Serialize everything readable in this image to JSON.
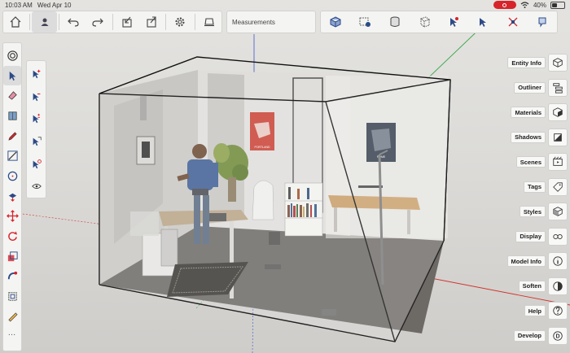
{
  "status_bar": {
    "time": "10:03 AM",
    "date": "Wed Apr 10",
    "battery": "40%",
    "battery_level": 0.4
  },
  "toolbar": {
    "measurements_placeholder": "Measurements"
  },
  "left_tools": [
    "orbit-icon",
    "select-icon",
    "eraser-icon",
    "paint-bucket-icon",
    "pencil-icon",
    "rectangle-icon",
    "circle-icon",
    "push-pull-icon",
    "move-icon",
    "rotate-icon",
    "scale-icon",
    "follow-me-icon",
    "offset-icon",
    "tape-measure-icon"
  ],
  "select_subtools": [
    "select-add-icon",
    "select-subtract-icon",
    "select-toggle-icon",
    "select-lasso-icon",
    "select-clear-icon",
    "select-all-icon"
  ],
  "right_panels": [
    {
      "label": "Entity Info",
      "icon": "entity-info-icon"
    },
    {
      "label": "Outliner",
      "icon": "outliner-icon"
    },
    {
      "label": "Materials",
      "icon": "materials-icon"
    },
    {
      "label": "Shadows",
      "icon": "shadows-icon"
    },
    {
      "label": "Scenes",
      "icon": "scenes-icon"
    },
    {
      "label": "Tags",
      "icon": "tags-icon"
    },
    {
      "label": "Styles",
      "icon": "styles-icon"
    },
    {
      "label": "Display",
      "icon": "display-icon"
    },
    {
      "label": "Model Info",
      "icon": "model-info-icon"
    },
    {
      "label": "Soften",
      "icon": "soften-icon"
    },
    {
      "label": "Help",
      "icon": "help-icon"
    },
    {
      "label": "Develop",
      "icon": "develop-icon"
    }
  ],
  "scene": {
    "poster_left_text": "PORTLAND",
    "poster_right_text": "ROME"
  },
  "colors": {
    "axis_red": "#d0342c",
    "axis_green": "#3aa84a",
    "axis_blue": "#3a56c8",
    "record": "#d8232a"
  }
}
